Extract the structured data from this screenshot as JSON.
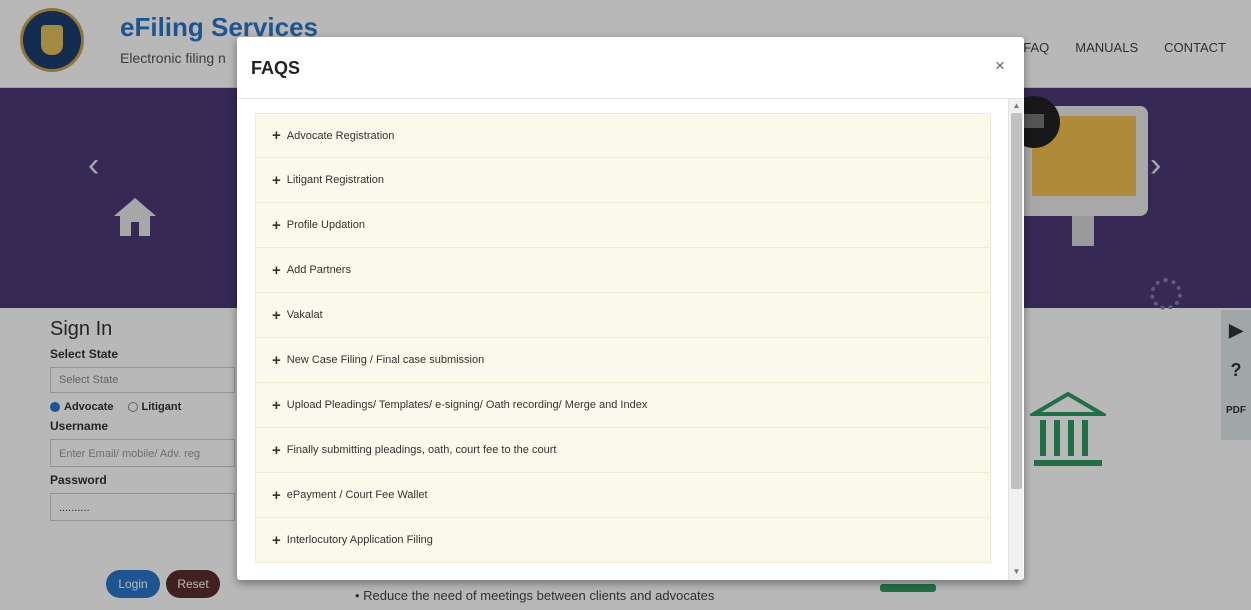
{
  "header": {
    "title": "eFiling Services",
    "subtitle": "Electronic filing n",
    "nav": [
      "FAQ",
      "MANUALS",
      "CONTACT"
    ]
  },
  "banner": {
    "prev_arrow": "‹",
    "next_arrow": "›"
  },
  "signin": {
    "title": "Sign In",
    "select_state_label": "Select State",
    "select_state_value": "Select State",
    "radio_advocate": "Advocate",
    "radio_litigant": "Litigant",
    "username_label": "Username",
    "username_placeholder": "Enter Email/ mobile/ Adv. reg",
    "password_label": "Password",
    "password_value": "..........",
    "login_button": "Login",
    "reset_button": "Reset"
  },
  "content": {
    "bullet_text": "• Reduce the need of meetings between clients and advocates"
  },
  "modal": {
    "title": "FAQS",
    "close_label": "×",
    "items": [
      {
        "label": "Advocate Registration"
      },
      {
        "label": "Litigant Registration"
      },
      {
        "label": "Profile Updation"
      },
      {
        "label": "Add Partners"
      },
      {
        "label": "Vakalat"
      },
      {
        "label": "New Case Filing / Final case submission"
      },
      {
        "label": "Upload Pleadings/ Templates/ e-signing/ Oath recording/ Merge and Index"
      },
      {
        "label": "Finally submitting pleadings, oath, court fee to the court"
      },
      {
        "label": "ePayment / Court Fee Wallet"
      },
      {
        "label": "Interlocutory Application Filing"
      }
    ],
    "expand_glyph": "+"
  },
  "side_tools": {
    "play_icon": "▶",
    "help_icon": "?",
    "pdf_icon": "PDF"
  },
  "colors": {
    "banner": "#4b3a78",
    "brand": "#2a77c9",
    "faq_item_bg": "#fbf9eb"
  }
}
